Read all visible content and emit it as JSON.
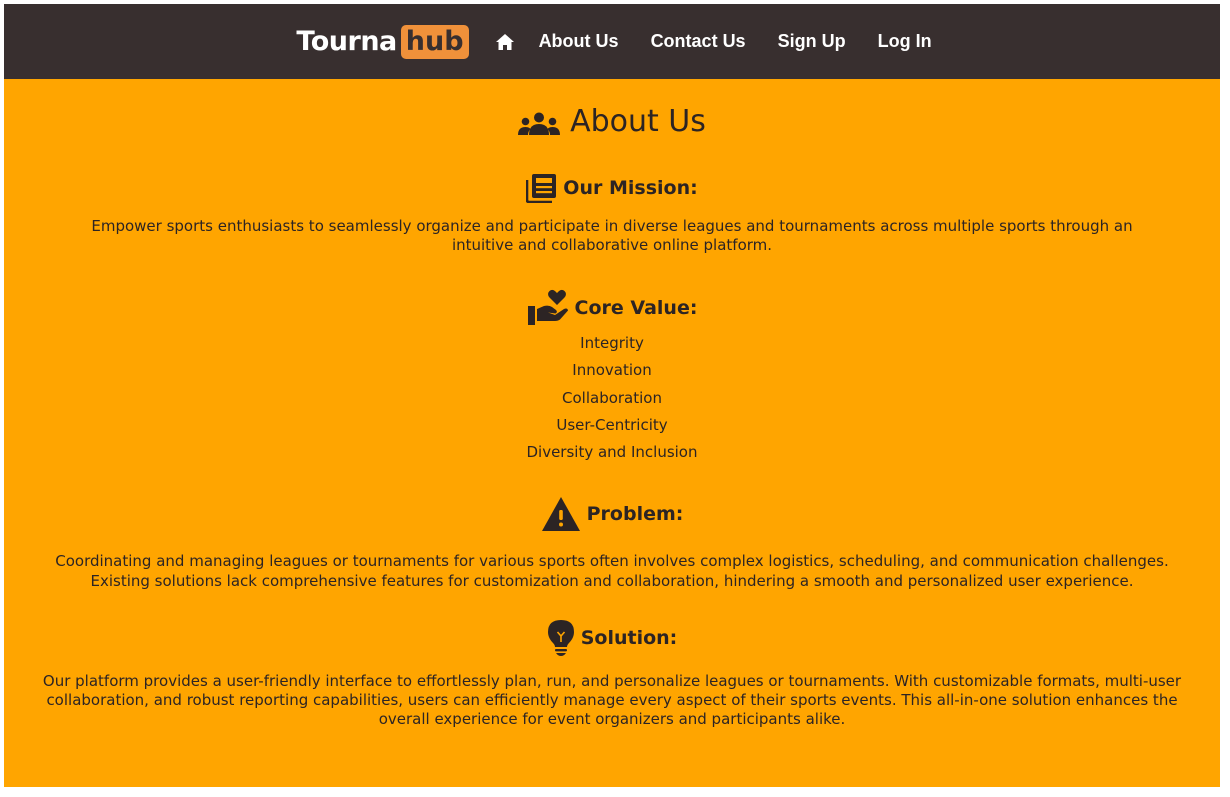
{
  "nav": {
    "logo_main": "Tourna",
    "logo_accent": "hub",
    "home_icon": "home-icon",
    "links": [
      "About Us",
      "Contact Us",
      "Sign Up",
      "Log In"
    ]
  },
  "page": {
    "title": "About Us",
    "title_icon": "users-icon"
  },
  "sections": {
    "mission": {
      "heading": "Our Mission:",
      "icon": "newspaper-icon",
      "text": "Empower sports enthusiasts to seamlessly organize and participate in diverse leagues and tournaments across multiple sports through an intuitive and collaborative online platform."
    },
    "core_value": {
      "heading": "Core Value:",
      "icon": "hand-holding-heart-icon",
      "items": [
        "Integrity",
        "Innovation",
        "Collaboration",
        "User-Centricity",
        "Diversity and Inclusion"
      ]
    },
    "problem": {
      "heading": "Problem:",
      "icon": "warning-icon",
      "text": "Coordinating and managing leagues or tournaments for various sports often involves complex logistics, scheduling, and communication challenges. Existing solutions lack comprehensive features for customization and collaboration, hindering a smooth and personalized user experience."
    },
    "solution": {
      "heading": "Solution:",
      "icon": "lightbulb-icon",
      "text": "Our platform provides a user-friendly interface to effortlessly plan, run, and personalize leagues or tournaments. With customizable formats, multi-user collaboration, and robust reporting capabilities, users can efficiently manage every aspect of their sports events. This all-in-one solution enhances the overall experience for event organizers and participants alike."
    }
  },
  "colors": {
    "navbar": "#382f2f",
    "background": "#ffa500",
    "logo_accent": "#f0913a",
    "text": "#2c2424"
  }
}
